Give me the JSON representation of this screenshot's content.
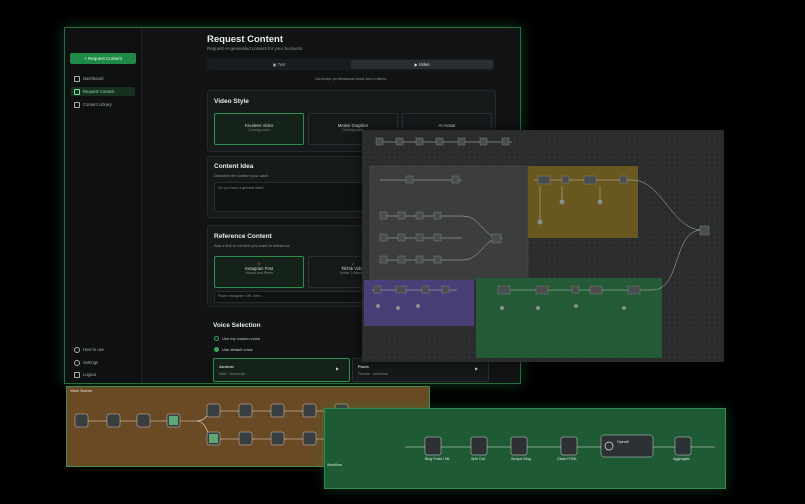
{
  "sidebar": {
    "request_button": "+ Request Content",
    "items": [
      {
        "label": "Dashboard"
      },
      {
        "label": "Request Content"
      },
      {
        "label": "Content Library"
      }
    ],
    "bottom_items": [
      {
        "label": "How to use"
      },
      {
        "label": "Settings"
      },
      {
        "label": "Logout"
      }
    ]
  },
  "page": {
    "title": "Request Content",
    "subtitle": "Request AI-generated content for your business.",
    "tabs": [
      "Text",
      "Video"
    ],
    "tab_caption": "Generate professional short-form videos"
  },
  "video_style": {
    "heading": "Video Style",
    "options": [
      {
        "title": "Faceless Video",
        "sub": "Coming soon"
      },
      {
        "title": "Motion Graphics",
        "sub": "Coming soon"
      },
      {
        "title": "AI Avatar",
        "sub": ""
      }
    ]
  },
  "content_idea": {
    "heading": "Content Idea",
    "desc": "Describe the content you want",
    "placeholder": "Do you have a general idea?"
  },
  "reference": {
    "heading": "Reference Content",
    "desc": "Add a link to content you want to reference",
    "options": [
      {
        "title": "Instagram Post",
        "sub": "Videos and Reels"
      },
      {
        "title": "TikTok Video",
        "sub": "Under 3 minutes"
      }
    ],
    "url_placeholder": "Paste Instagram URL here..."
  },
  "voice": {
    "heading": "Voice Selection",
    "radios": [
      "Use my custom voice",
      "Use default voice"
    ],
    "voices": [
      {
        "name": "Andrew",
        "meta": "Male · American"
      },
      {
        "name": "Paola",
        "meta": "Female · American"
      }
    ]
  },
  "workflows": {
    "wf3_labels": [
      "Loop Over Items",
      "Blog Posts / ML",
      "Split Out",
      "Scrape Blog",
      "Clean HTML",
      "OpenAI",
      "Aggregate"
    ],
    "wf3_caption": "Workflow",
    "wf2_title": "Video Scenes"
  },
  "colors": {
    "accent": "#1f8a45",
    "app_bg": "#111314",
    "orange_group": "#6a4a24",
    "green_group": "#1e5a34",
    "purple_group": "#453a6e"
  }
}
